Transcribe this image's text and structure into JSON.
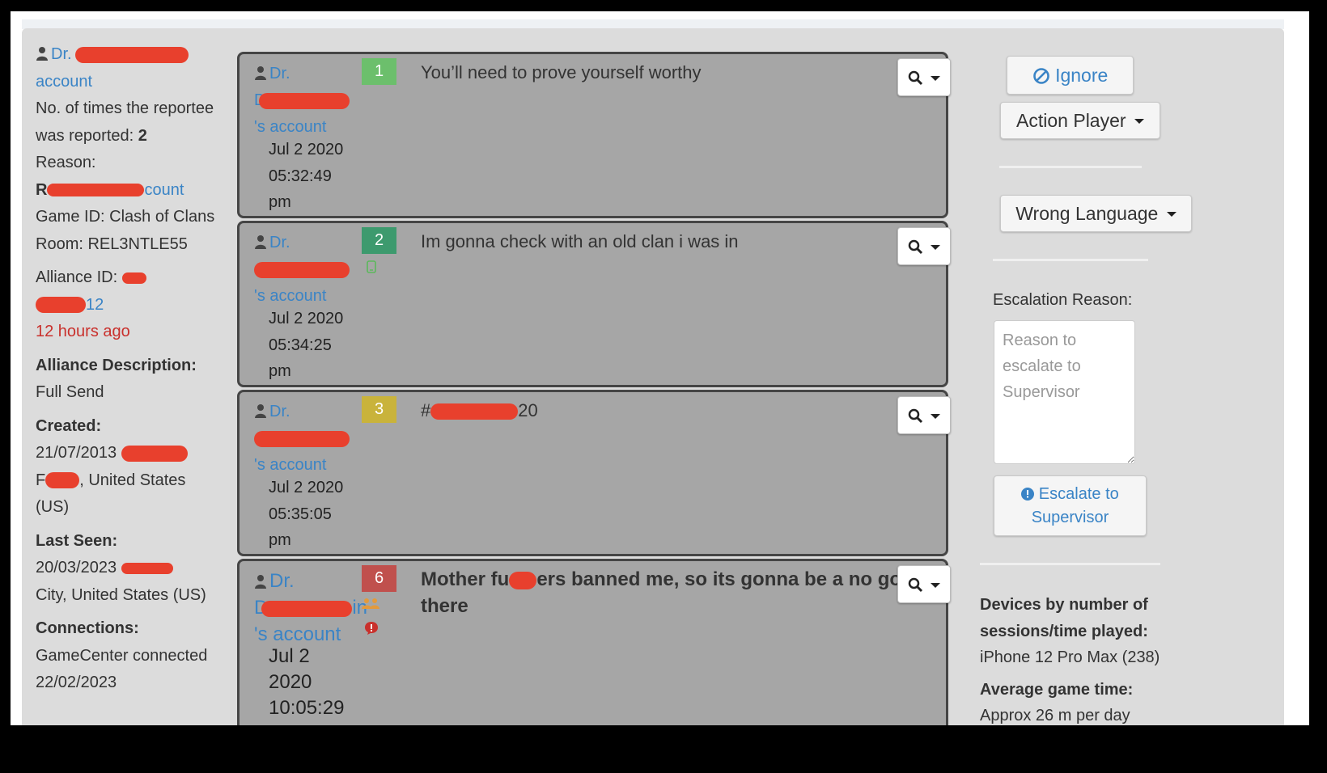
{
  "reportee": {
    "name_prefix": "Dr.",
    "account_suffix": "account",
    "times_reported_label": "No. of times the reportee was reported:",
    "times_reported_value": "2",
    "reason_label": "Reason:",
    "reason_start": "R",
    "reason_end": "count",
    "game_id": "Game ID: Clash of Clans",
    "room": "Room: REL3NTLE55",
    "alliance_label": "Alliance ID:",
    "alliance_suffix": "12",
    "time_ago": "12 hours ago",
    "alliance_desc_label": "Alliance Description:",
    "alliance_desc": "Full Send",
    "created_label": "Created:",
    "created_date": "21/07/2013",
    "created_location": ", United States (US)",
    "created_location_prefix": "F",
    "last_seen_label": "Last Seen:",
    "last_seen_date": "20/03/2023",
    "last_seen_location": "City, United States (US)",
    "connections_label": "Connections:",
    "connections_value": "GameCenter connected 22/02/2023"
  },
  "messages": [
    {
      "author_prefix": "Dr.",
      "author_mid": "Du",
      "author_suffix": "'s account",
      "num": "1",
      "num_color": "#6cbf6c",
      "date": "Jul 2 2020",
      "time": "05:32:49",
      "ampm": "pm",
      "text": "You’ll need to prove yourself worthy",
      "bold": false
    },
    {
      "author_prefix": "Dr.",
      "author_mid": "",
      "author_suffix": "'s account",
      "num": "2",
      "num_color": "#3d9a6e",
      "date": "Jul 2 2020",
      "time": "05:34:25",
      "ampm": "pm",
      "text": "Im gonna check with an old clan i was in",
      "bold": false
    },
    {
      "author_prefix": "Dr.",
      "author_mid": "",
      "author_suffix": "'s account",
      "num": "3",
      "num_color": "#c9b33b",
      "date": "Jul 2 2020",
      "time": "05:35:05",
      "ampm": "pm",
      "text_prefix": "#",
      "text_suffix": "20",
      "bold": false
    },
    {
      "author_prefix": "Dr.",
      "author_mid": "D",
      "author_mid_end": "in",
      "author_suffix": "'s account",
      "num": "6",
      "num_color": "#c0504d",
      "date": "Jul 2",
      "year": "2020",
      "time": "10:05:29",
      "text_a": "Mother fu",
      "text_b": "ers banned me, so its gonna be a no go there",
      "bold": true
    }
  ],
  "actions": {
    "ignore_label": "Ignore",
    "action_player_label": "Action Player",
    "language_label": "Wrong Language",
    "escalation_label": "Escalation Reason:",
    "escalation_placeholder": "Reason to escalate to Supervisor",
    "escalate_label_1": "Escalate to",
    "escalate_label_2": "Supervisor"
  },
  "devices": {
    "label": "Devices by number of sessions/time played:",
    "value": "iPhone 12 Pro Max (238)",
    "avg_label": "Average game time:",
    "avg_value": "Approx 26 m per day"
  },
  "colors": {
    "link": "#3a84c6",
    "redaction": "#e8402d",
    "time_ago": "#c9302c"
  }
}
